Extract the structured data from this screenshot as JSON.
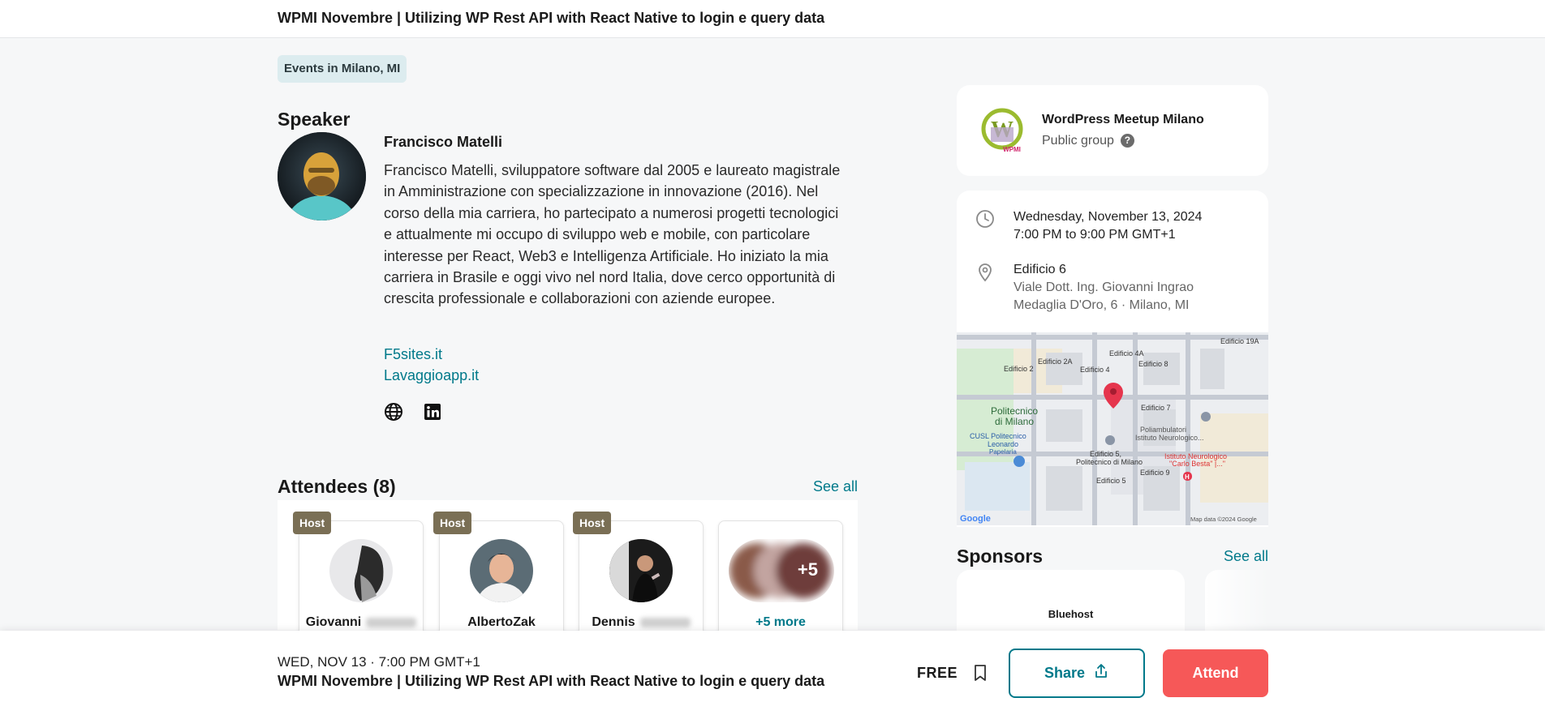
{
  "header": {
    "title": "WPMI Novembre | Utilizing WP Rest API with React Native to login e query data"
  },
  "tag": "Events in Milano, MI",
  "speaker": {
    "heading": "Speaker",
    "name": "Francisco Matelli",
    "bio": "Francisco Matelli, sviluppatore software dal 2005 e laureato magistrale in Amministrazione con specializzazione in innovazione (2016). Nel corso della mia carriera, ho partecipato a numerosi progetti tecnologici e attualmente mi occupo di sviluppo web e mobile, con particolare interesse per React, Web3 e Intelligenza Artificiale. Ho iniziato la mia carriera in Brasile e oggi vivo nel nord Italia, dove cerco opportunità di crescita professionale e collaborazioni con aziende europee.",
    "links": [
      "F5sites.it",
      "Lavaggioapp.it"
    ],
    "social_icons": [
      "globe-icon",
      "linkedin-icon"
    ]
  },
  "attendees": {
    "heading": "Attendees (8)",
    "see_all": "See all",
    "cards": [
      {
        "badge": "Host",
        "name": "Giovanni"
      },
      {
        "badge": "Host",
        "name": "AlbertoZak"
      },
      {
        "badge": "Host",
        "name": "Dennis"
      },
      {
        "badge": "",
        "name": "+5 more",
        "count": "+5"
      }
    ]
  },
  "group": {
    "name": "WordPress Meetup Milano",
    "type": "Public group",
    "help": "?",
    "logo_text": "WPMI"
  },
  "event": {
    "date": "Wednesday, November 13, 2024",
    "time": "7:00 PM to 9:00 PM GMT+1",
    "venue": "Edificio 6",
    "address1": "Viale Dott. Ing. Giovanni Ingrao",
    "address2": "Medaglia D'Oro, 6 · Milano, MI"
  },
  "map": {
    "labels": [
      "Edificio 19A",
      "Edificio 4A",
      "Edificio 8",
      "Edificio 2A",
      "Edificio 2",
      "Edificio 4",
      "Politecnico",
      "di Milano",
      "Edificio 7",
      "Poliambulatori",
      "Istituto Neurologico...",
      "CUSL Politecnico",
      "Leonardo",
      "Papelaria",
      "Edificio 5,",
      "Politecnico di Milano",
      "Istituto Neurologico",
      "\"Carlo Besta\" |...\"",
      "Edificio 9",
      "Edificio 5"
    ],
    "google": "Google",
    "attribution": "Map data ©2024 Google"
  },
  "sponsors": {
    "heading": "Sponsors",
    "see_all": "See all",
    "items": [
      "Bluehost"
    ]
  },
  "bottom_bar": {
    "date": "WED, NOV 13 · 7:00 PM GMT+1",
    "title": "WPMI Novembre | Utilizing WP Rest API with React Native to login e query data",
    "price": "FREE",
    "share_label": "Share",
    "attend_label": "Attend"
  },
  "colors": {
    "accent": "#00798a",
    "attend": "#f65858",
    "host_badge": "#7a6f55"
  }
}
